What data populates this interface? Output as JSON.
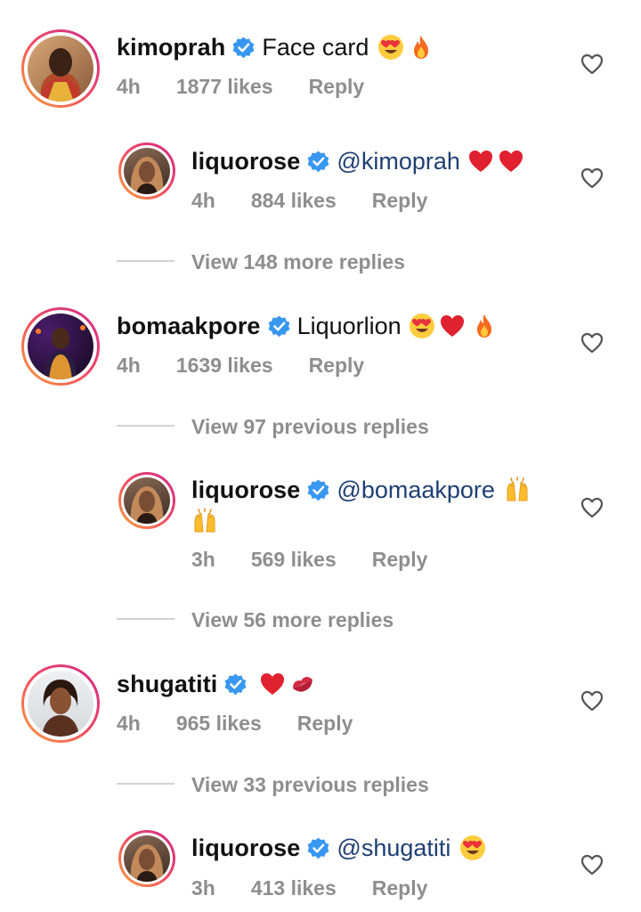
{
  "comments": [
    {
      "username": "kimoprah",
      "text": "Face card",
      "time": "4h",
      "likes": "1877 likes",
      "reply": "Reply"
    },
    {
      "username": "liquorose",
      "mention": "@kimoprah",
      "time": "4h",
      "likes": "884 likes",
      "reply": "Reply"
    },
    {
      "username": "bomaakpore",
      "text": "Liquorlion",
      "time": "4h",
      "likes": "1639 likes",
      "reply": "Reply"
    },
    {
      "username": "liquorose",
      "mention": "@bomaakpore",
      "time": "3h",
      "likes": "569 likes",
      "reply": "Reply"
    },
    {
      "username": "shugatiti",
      "text": "",
      "time": "4h",
      "likes": "965 likes",
      "reply": "Reply"
    },
    {
      "username": "liquorose",
      "mention": "@shugatiti",
      "time": "3h",
      "likes": "413 likes",
      "reply": "Reply"
    }
  ],
  "view_replies": [
    "View 148 more replies",
    "View 97 previous replies",
    "View 56 more replies",
    "View 33 previous replies"
  ],
  "icons": {
    "verified": "verified-badge-icon",
    "like": "heart-outline-icon",
    "emoji_heart_eyes": "heart-eyes-emoji",
    "emoji_fire": "fire-emoji",
    "emoji_red_heart": "red-heart-emoji",
    "emoji_raised_hands": "raised-hands-emoji",
    "emoji_kiss": "kiss-mark-emoji"
  },
  "colors": {
    "verified_blue": "#3897f0",
    "meta_gray": "#8e8e8e",
    "mention": "#1f3f73",
    "ring_start": "#f9a23a",
    "ring_end": "#d1288a"
  }
}
